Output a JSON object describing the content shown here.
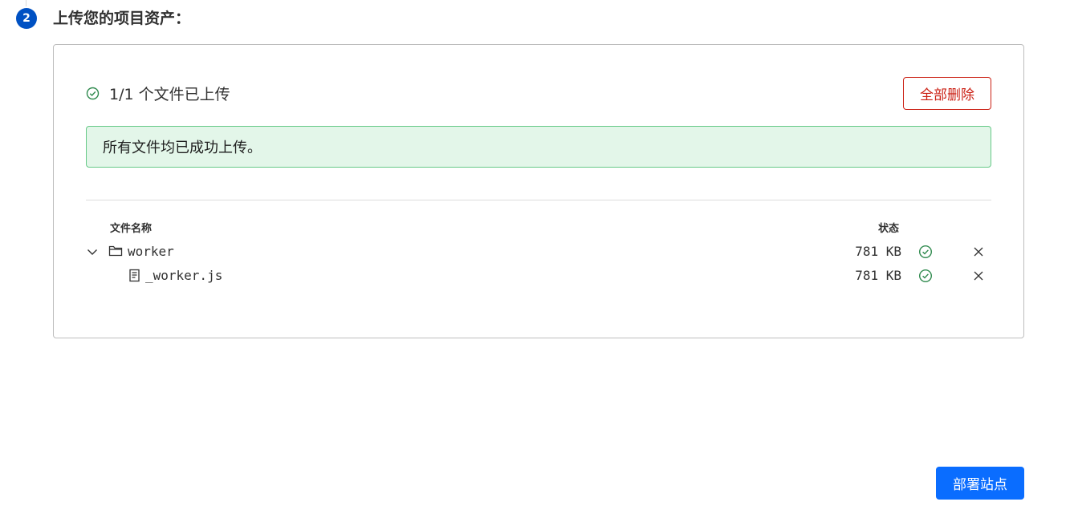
{
  "step": {
    "number": "2",
    "title": "上传您的项目资产："
  },
  "upload": {
    "summary": "1/1 个文件已上传",
    "delete_all_label": "全部删除",
    "success_message": "所有文件均已成功上传。"
  },
  "table": {
    "col_name": "文件名称",
    "col_status": "状态",
    "rows": [
      {
        "name": "worker",
        "type": "folder",
        "size": "781 KB",
        "expanded": true,
        "status": "uploaded"
      },
      {
        "name": "_worker.js",
        "type": "file",
        "size": "781 KB",
        "status": "uploaded"
      }
    ]
  },
  "actions": {
    "deploy_label": "部署站点"
  },
  "colors": {
    "primary": "#0a6dff",
    "step_badge": "#0051c3",
    "danger": "#cb2014",
    "success": "#2f8a4e",
    "success_bg": "#e3f6e9",
    "success_border": "#66c987"
  }
}
